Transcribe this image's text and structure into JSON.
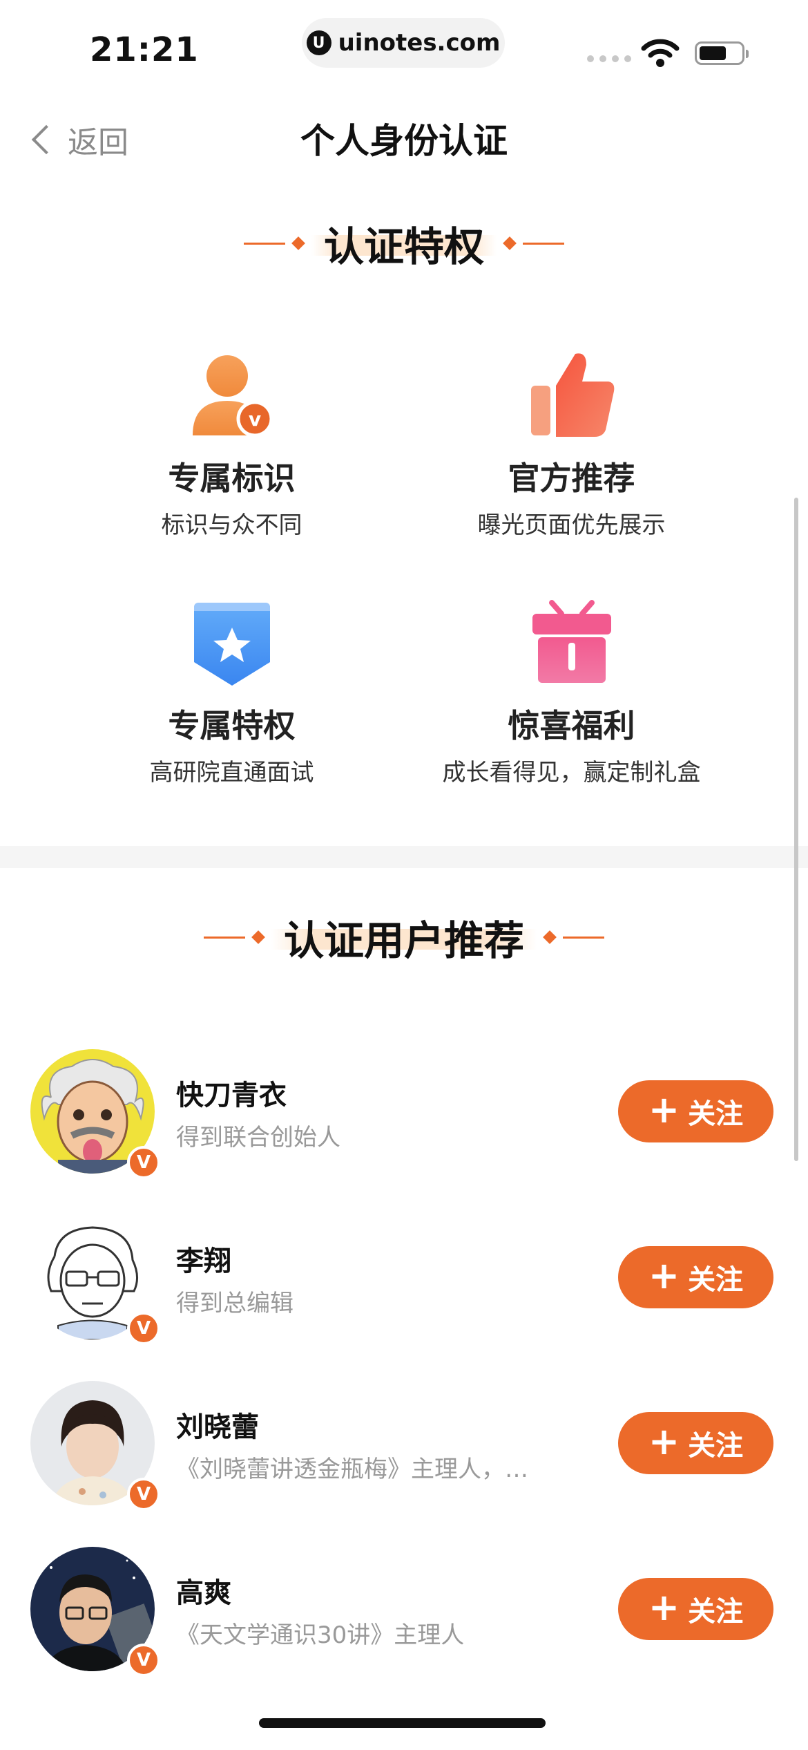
{
  "status_bar": {
    "time": "21:21",
    "url": "uinotes.com"
  },
  "nav": {
    "back_label": "返回",
    "title": "个人身份认证"
  },
  "privileges": {
    "heading": "认证特权",
    "items": [
      {
        "name": "专属标识",
        "desc": "标识与众不同",
        "icon": "user-verified-icon"
      },
      {
        "name": "官方推荐",
        "desc": "曝光页面优先展示",
        "icon": "thumbs-up-icon"
      },
      {
        "name": "专属特权",
        "desc": "高研院直通面试",
        "icon": "star-shield-icon"
      },
      {
        "name": "惊喜福利",
        "desc": "成长看得见，赢定制礼盒",
        "icon": "gift-icon"
      }
    ]
  },
  "recommend": {
    "heading": "认证用户推荐",
    "badge": "V",
    "follow_label": "关注",
    "users": [
      {
        "name": "快刀青衣",
        "bio": "得到联合创始人"
      },
      {
        "name": "李翔",
        "bio": "得到总编辑"
      },
      {
        "name": "刘晓蕾",
        "bio": "《刘晓蕾讲透金瓶梅》主理人，…"
      },
      {
        "name": "高爽",
        "bio": "《天文学通识30讲》主理人"
      }
    ]
  },
  "colors": {
    "accent": "#ec6a2a",
    "muted": "#999999"
  }
}
